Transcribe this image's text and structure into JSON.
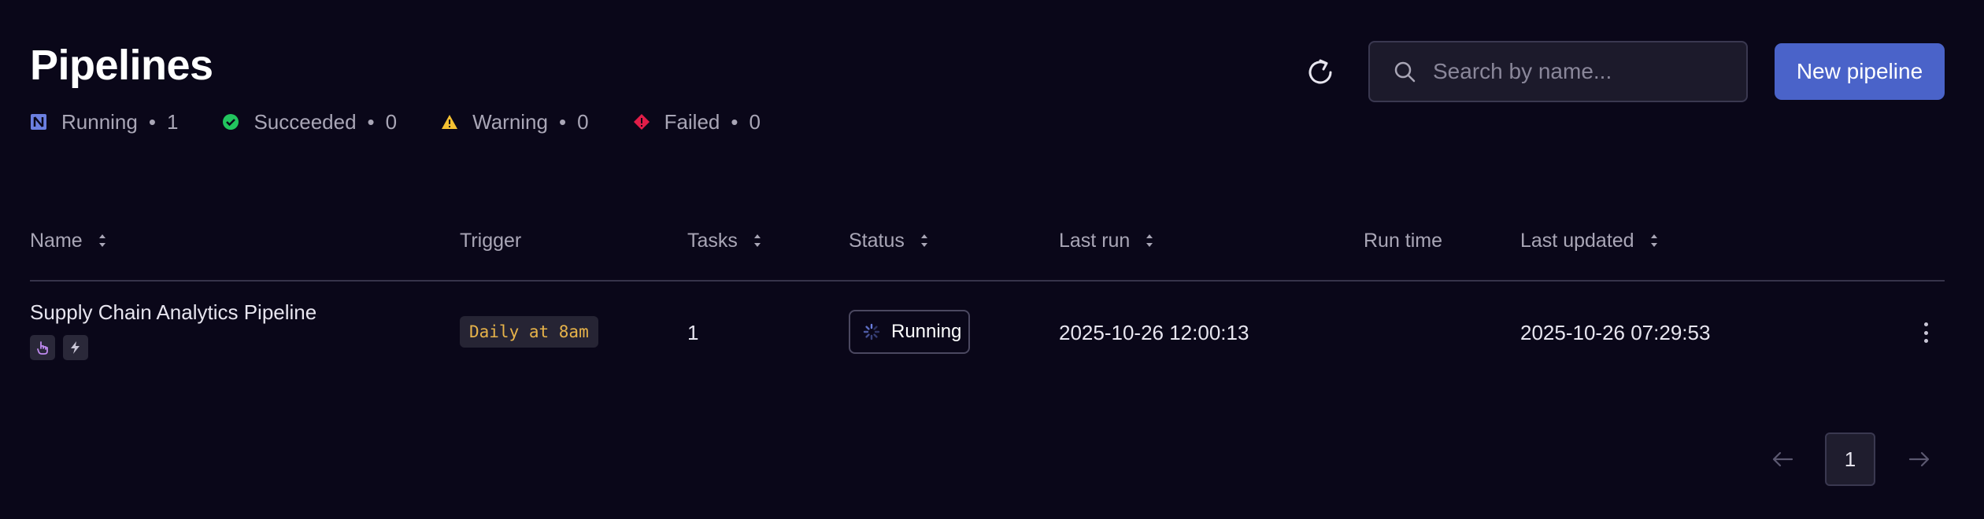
{
  "header": {
    "title": "Pipelines",
    "summary": [
      {
        "icon": "running-icon",
        "label": "Running",
        "count": "1"
      },
      {
        "icon": "check-circle-icon",
        "label": "Succeeded",
        "count": "0"
      },
      {
        "icon": "warning-icon",
        "label": "Warning",
        "count": "0"
      },
      {
        "icon": "failed-icon",
        "label": "Failed",
        "count": "0"
      }
    ],
    "separator": "•"
  },
  "toolbar": {
    "search_placeholder": "Search by name...",
    "new_label": "New pipeline"
  },
  "table": {
    "columns": [
      {
        "label": "Name",
        "sortable": true
      },
      {
        "label": "Trigger",
        "sortable": false
      },
      {
        "label": "Tasks",
        "sortable": true
      },
      {
        "label": "Status",
        "sortable": true
      },
      {
        "label": "Last run",
        "sortable": true
      },
      {
        "label": "Run time",
        "sortable": false
      },
      {
        "label": "Last updated",
        "sortable": true
      }
    ],
    "rows": [
      {
        "name": "Supply Chain Analytics Pipeline",
        "badges": [
          "pointer-hand-icon",
          "bolt-icon"
        ],
        "trigger": "Daily at 8am",
        "tasks": "1",
        "status": "Running",
        "last_run": "2025-10-26 12:00:13",
        "run_time": "",
        "last_updated": "2025-10-26 07:29:53"
      }
    ]
  },
  "pagination": {
    "current_page": "1"
  },
  "colors": {
    "background": "#0a0719",
    "accent": "#4a63c9",
    "running": "#6b7fe0",
    "succeeded": "#22c55e",
    "warning": "#f5c132",
    "failed": "#e11d48",
    "trigger_text": "#e7b34a"
  }
}
